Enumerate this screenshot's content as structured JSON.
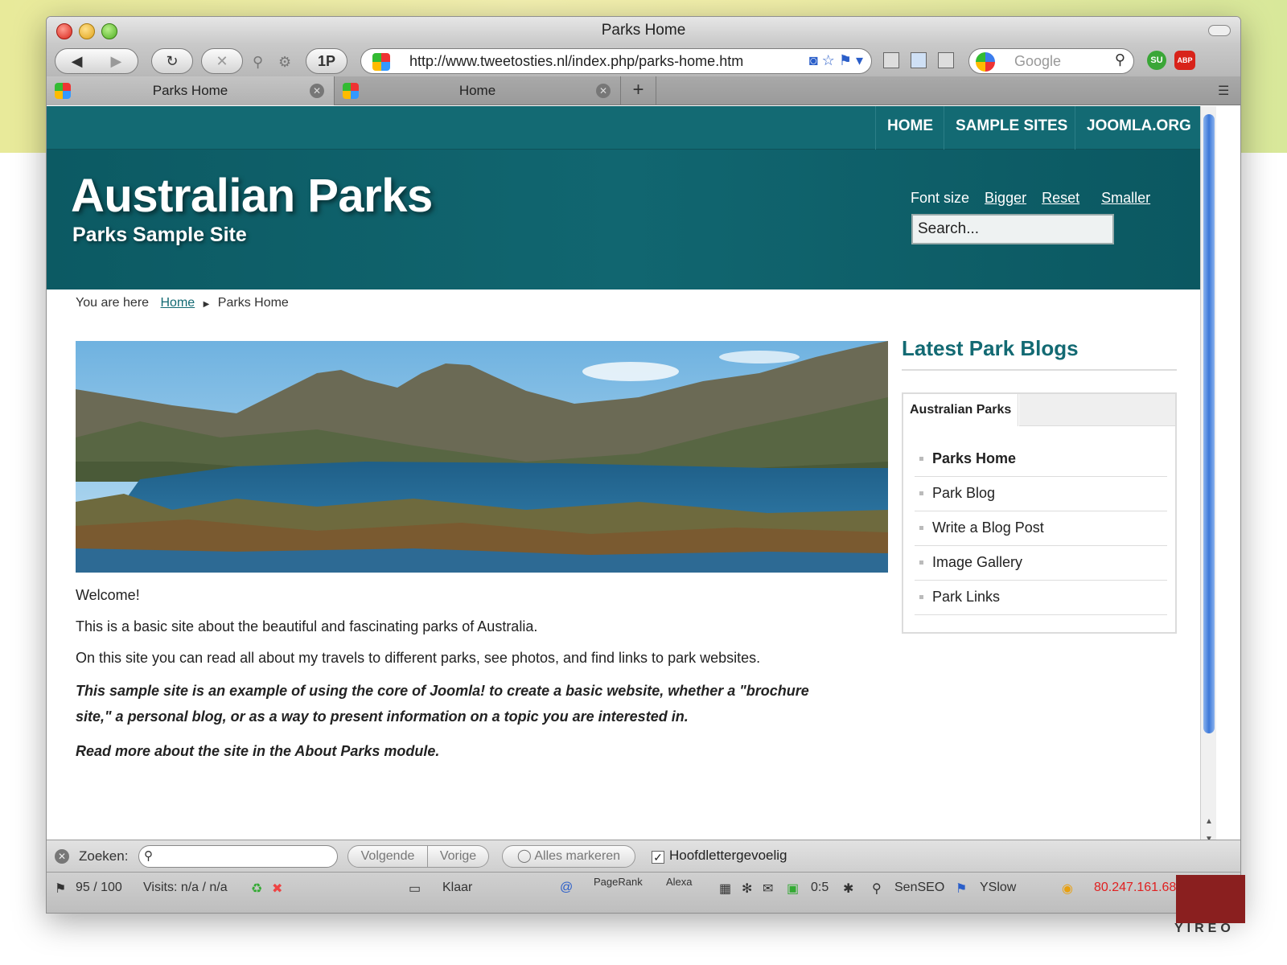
{
  "browser": {
    "window_title": "Parks Home",
    "toolbar": {
      "back": "◀",
      "forward": "▶",
      "reload": "↻",
      "stop": "✕",
      "onepassword": "1P",
      "url": "http://www.tweetosties.nl/index.php/parks-home.htm",
      "google_placeholder": "Google"
    },
    "tabs": [
      {
        "label": "Parks Home",
        "active": true
      },
      {
        "label": "Home",
        "active": false
      }
    ],
    "new_tab": "+"
  },
  "site": {
    "nav": [
      "HOME",
      "SAMPLE SITES",
      "JOOMLA.ORG"
    ],
    "title": "Australian Parks",
    "subtitle": "Parks Sample Site",
    "font_size": {
      "label": "Font size",
      "bigger": "Bigger",
      "reset": "Reset",
      "smaller": "Smaller"
    },
    "search_placeholder": "Search...",
    "breadcrumb": {
      "prefix": "You are here",
      "home": "Home",
      "current": "Parks Home"
    },
    "article": {
      "p1": "Welcome!",
      "p2": "This is a basic site about the beautiful and fascinating parks of Australia.",
      "p3": "On this site you can read all about my travels to different parks, see photos, and find links to park websites.",
      "p4": "This sample site is an example of using the core of Joomla! to create a basic website, whether a \"brochure site,\"  a personal blog, or as a way to present information on a topic you are interested in.",
      "p5": "Read more about the site in the About Parks module."
    },
    "sidebar": {
      "title": "Latest Park Blogs",
      "tab": "Australian Parks",
      "items": [
        "Parks Home",
        "Park Blog",
        "Write a Blog Post",
        "Image Gallery",
        "Park Links"
      ]
    }
  },
  "findbar": {
    "label": "Zoeken:",
    "next": "Volgende",
    "prev": "Vorige",
    "highlight_all": "Alles markeren",
    "match_case": "Hoofdlettergevoelig"
  },
  "statusbar": {
    "score": "95 / 100",
    "visits": "Visits: n/a / n/a",
    "status": "Klaar",
    "pagerank": "PageRank",
    "alexa": "Alexa",
    "timer": "0:5",
    "senseo": "SenSEO",
    "yslow": "YSlow",
    "ip": "80.247.161.68"
  },
  "logo": {
    "text": "YIREO"
  },
  "colors": {
    "brand_teal": "#136a73",
    "ip_red": "#e02020"
  }
}
